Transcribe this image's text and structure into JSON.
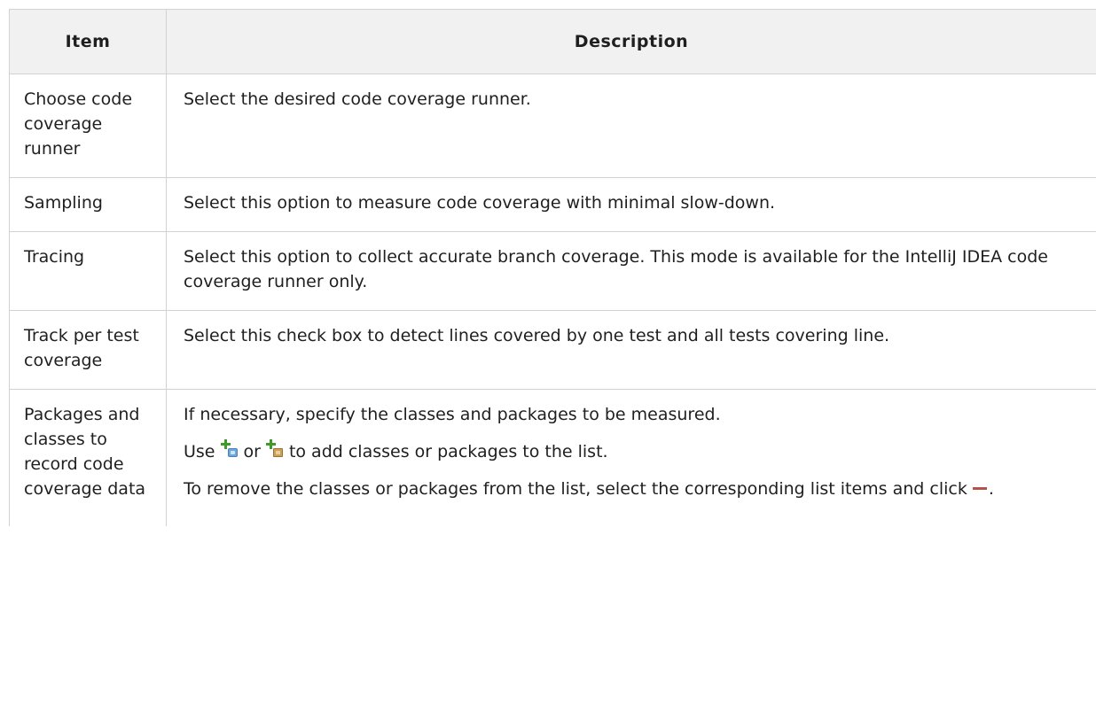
{
  "table": {
    "headers": {
      "item": "Item",
      "description": "Description"
    },
    "rows": [
      {
        "item": "Choose code coverage runner",
        "description": "Select the desired code coverage runner."
      },
      {
        "item": "Sampling",
        "description": "Select this option to measure code coverage with minimal slow-down."
      },
      {
        "item": "Tracing",
        "description": "Select this option to collect accurate branch coverage. This mode is available for the IntelliJ IDEA code coverage runner only."
      },
      {
        "item": "Track per test coverage",
        "description": "Select this check box to detect lines covered by one test and all tests covering line."
      },
      {
        "item": "Packages and classes to record code coverage data",
        "para1": "If necessary, specify the classes and packages to be measured.",
        "para2": {
          "prefix": "Use",
          "connector": "or",
          "suffix": "to add classes or packages to the list.",
          "icons": [
            "add-class-icon",
            "add-package-icon"
          ]
        },
        "para3": {
          "text": "To remove the classes or packages from the list, select the corresponding list items and click",
          "end": ".",
          "icon": "remove-icon"
        }
      }
    ]
  },
  "colors": {
    "header_background": "#f1f1f1",
    "border": "#d2d2d2",
    "text": "#1f1f1f",
    "add_green": "#3f9a2a",
    "remove_red": "#b5524a"
  }
}
